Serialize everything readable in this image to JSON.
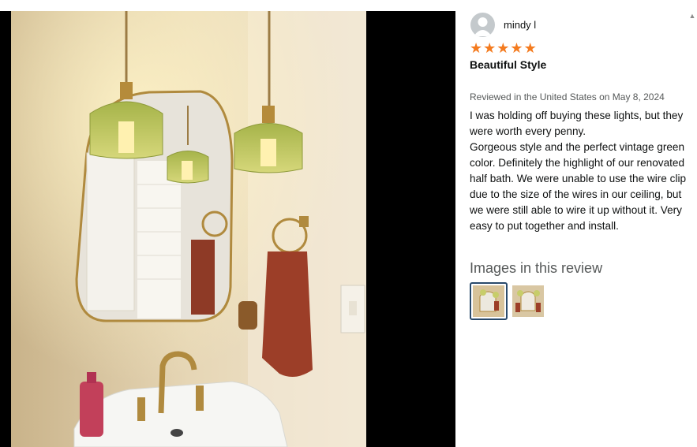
{
  "review": {
    "author": "mindy l",
    "rating": 5,
    "max_rating": 5,
    "star_glyph": "★",
    "title": "Beautiful Style",
    "meta": "Reviewed in the United States on May 8, 2024",
    "body": "I was holding off buying these lights, but they were worth every penny.\nGorgeous style and the perfect vintage green color. Definitely the highlight of our renovated half bath. We were unable to use the wire clip due to the size of the wires in our ceiling, but we were still able to wire it up without it. Very easy to put together and install."
  },
  "images_section": {
    "heading": "Images in this review",
    "thumbnails": [
      {
        "icon": "photo-thumbnail",
        "selected": true
      },
      {
        "icon": "photo-thumbnail",
        "selected": false
      }
    ]
  },
  "colors": {
    "star": "#f47b1f",
    "selected_border": "#2a4a6b"
  },
  "scroll": {
    "icon": "scroll-up-arrow-icon",
    "glyph": "▲"
  }
}
